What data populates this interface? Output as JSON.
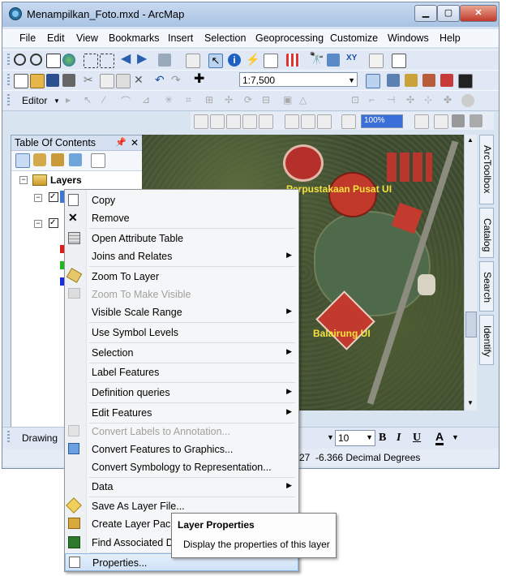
{
  "window": {
    "title": "Menampilkan_Foto.mxd - ArcMap",
    "controls": {
      "minimize": "▁",
      "maximize": "▢",
      "close": "✕"
    }
  },
  "menu": [
    "File",
    "Edit",
    "View",
    "Bookmarks",
    "Insert",
    "Selection",
    "Geoprocessing",
    "Customize",
    "Windows",
    "Help"
  ],
  "toolbar": {
    "scale": "1:7,500",
    "editor_label": "Editor",
    "zoom_level": "100%"
  },
  "toc": {
    "title": "Table Of Contents",
    "root_layer": "Layers",
    "legend_colors": [
      "#e01b1b",
      "#1fb81f",
      "#1b2be0"
    ]
  },
  "map": {
    "labels": [
      "Perpustakaan Pusat UI",
      "Balairung UI"
    ]
  },
  "right_tabs": [
    "ArcToolbox",
    "Catalog",
    "Search",
    "Identify"
  ],
  "drawing_toolbar": {
    "label": "Drawing",
    "font_size": "10",
    "bold": "B",
    "italic": "I",
    "underline": "U",
    "font_color": "A"
  },
  "status_bar": {
    "coords": "27  -6.366 Decimal Degrees"
  },
  "context_menu": {
    "items": [
      {
        "label": "Copy",
        "icon": "copy-icon",
        "enabled": true,
        "submenu": false
      },
      {
        "label": "Remove",
        "icon": "remove-icon",
        "enabled": true,
        "submenu": false
      },
      {
        "label": "Open Attribute Table",
        "icon": "table-icon",
        "enabled": true,
        "submenu": false
      },
      {
        "label": "Joins and Relates",
        "icon": "",
        "enabled": true,
        "submenu": true
      },
      {
        "label": "Zoom To Layer",
        "icon": "zoom-layer-icon",
        "enabled": true,
        "submenu": false
      },
      {
        "label": "Zoom To Make Visible",
        "icon": "zoom-visible-icon",
        "enabled": false,
        "submenu": false
      },
      {
        "label": "Visible Scale Range",
        "icon": "",
        "enabled": true,
        "submenu": true
      },
      {
        "label": "Use Symbol Levels",
        "icon": "",
        "enabled": true,
        "submenu": false
      },
      {
        "label": "Selection",
        "icon": "",
        "enabled": true,
        "submenu": true
      },
      {
        "label": "Label Features",
        "icon": "",
        "enabled": true,
        "submenu": false
      },
      {
        "label": "Definition queries",
        "icon": "",
        "enabled": true,
        "submenu": true
      },
      {
        "label": "Edit Features",
        "icon": "",
        "enabled": true,
        "submenu": true
      },
      {
        "label": "Convert Labels to Annotation...",
        "icon": "convert-labels-icon",
        "enabled": false,
        "submenu": false
      },
      {
        "label": "Convert Features to Graphics...",
        "icon": "convert-graphics-icon",
        "enabled": true,
        "submenu": false
      },
      {
        "label": "Convert Symbology to Representation...",
        "icon": "",
        "enabled": true,
        "submenu": false
      },
      {
        "label": "Data",
        "icon": "",
        "enabled": true,
        "submenu": true
      },
      {
        "label": "Save As Layer File...",
        "icon": "layer-file-icon",
        "enabled": true,
        "submenu": false
      },
      {
        "label": "Create Layer Package...",
        "icon": "layer-package-icon",
        "enabled": true,
        "submenu": false
      },
      {
        "label": "Find Associated Documents",
        "icon": "find-docs-icon",
        "enabled": true,
        "submenu": false
      },
      {
        "label": "Properties...",
        "icon": "properties-icon",
        "enabled": true,
        "submenu": false
      }
    ]
  },
  "tooltip": {
    "title": "Layer Properties",
    "text": "Display the properties of this layer"
  }
}
